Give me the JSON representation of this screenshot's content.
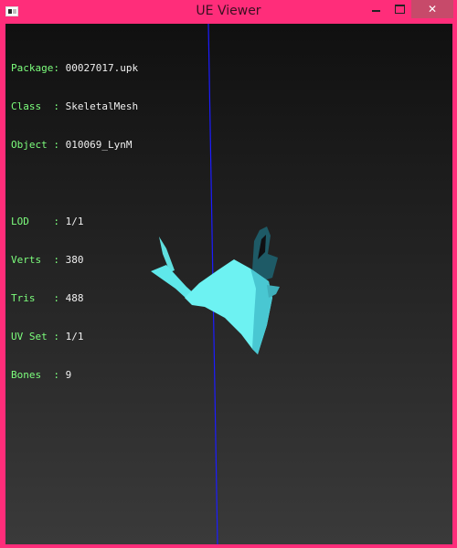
{
  "window": {
    "title": "UE Viewer",
    "controls": {
      "minimize": "—",
      "maximize": "□",
      "close": "✕"
    },
    "titlebar_color": "#ff2d7a",
    "close_button_color": "#c74a6a"
  },
  "info": {
    "package": {
      "label": "Package: ",
      "value": "00027017.upk"
    },
    "class": {
      "label": "Class  : ",
      "value": "SkeletalMesh"
    },
    "object": {
      "label": "Object : ",
      "value": "010069_LynM"
    },
    "lod": {
      "label": "LOD    : ",
      "value": "1/1"
    },
    "verts": {
      "label": "Verts  : ",
      "value": "380"
    },
    "tris": {
      "label": "Tris   : ",
      "value": "488"
    },
    "uvset": {
      "label": "UV Set : ",
      "value": "1/1"
    },
    "bones": {
      "label": "Bones  : ",
      "value": "9"
    },
    "label_color": "#7dff7d",
    "value_color": "#f0f0f0"
  },
  "viewport": {
    "background_top": "#101010",
    "background_bottom": "#3a3a3a",
    "axis_color": "#1c1cff",
    "mesh_color": "#6df2f2"
  }
}
